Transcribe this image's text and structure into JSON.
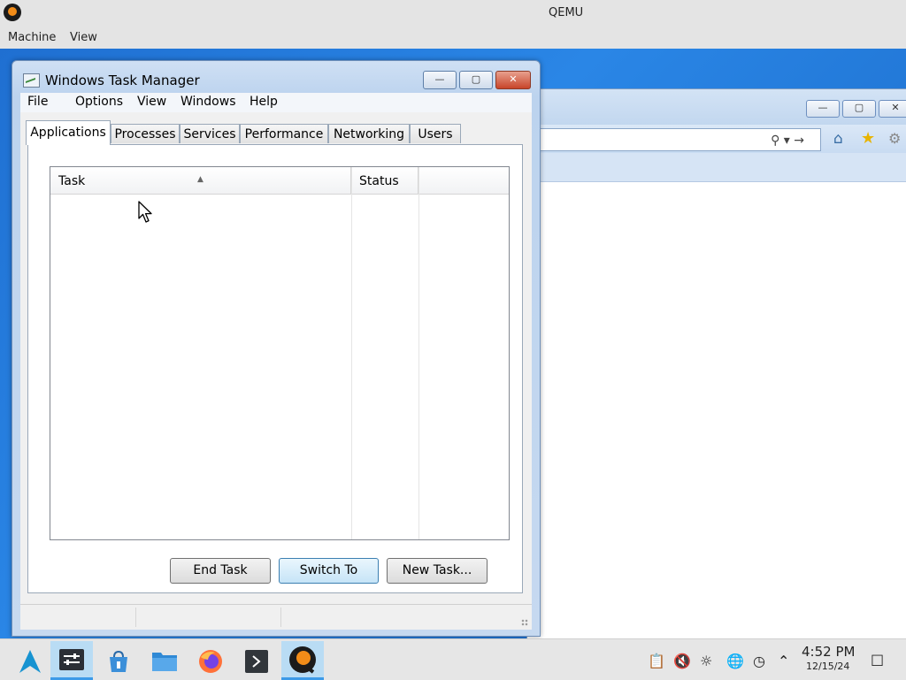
{
  "host": {
    "title": "QEMU",
    "menu": [
      "Machine",
      "View"
    ]
  },
  "task_manager": {
    "title": "Windows Task Manager",
    "menu": [
      "File",
      "Options",
      "View",
      "Windows",
      "Help"
    ],
    "tabs": [
      "Applications",
      "Processes",
      "Services",
      "Performance",
      "Networking",
      "Users"
    ],
    "active_tab": "Applications",
    "columns": [
      "Task",
      "Status"
    ],
    "rows": [],
    "buttons": {
      "end_task": "End Task",
      "switch_to": "Switch To",
      "new_task": "New Task..."
    }
  },
  "taskbar": {
    "apps": [
      "app-launcher-icon",
      "system-settings-icon",
      "package-store-icon",
      "file-manager-icon",
      "firefox-icon",
      "terminal-icon",
      "qemu-icon"
    ],
    "active_app": "qemu-icon",
    "clock": {
      "time": "4:52 PM",
      "date": "12/15/24"
    }
  },
  "colors": {
    "desktop": "#1f6fd1",
    "accent": "#3c9ae8",
    "close_button": "#c8452a"
  }
}
